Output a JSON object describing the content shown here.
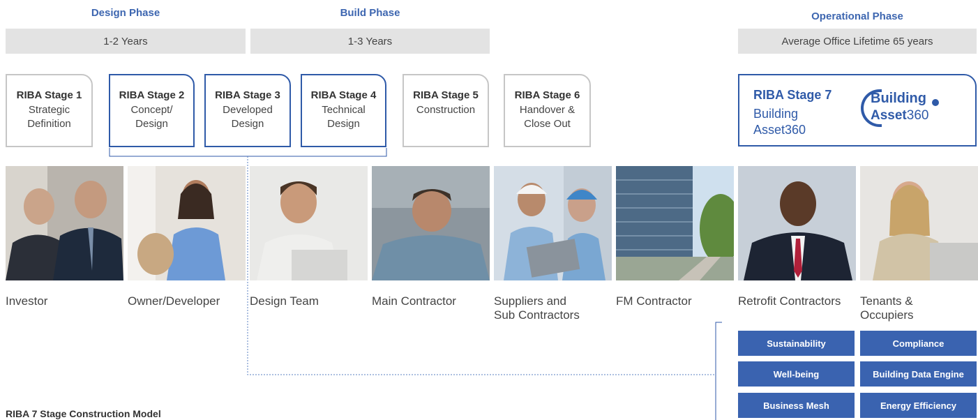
{
  "phases": {
    "design": {
      "title": "Design Phase",
      "duration": "1-2 Years"
    },
    "build": {
      "title": "Build Phase",
      "duration": "1-3 Years"
    },
    "operational": {
      "title": "Operational Phase",
      "duration": "Average Office Lifetime 65 years"
    }
  },
  "stages": [
    {
      "title": "RIBA Stage 1",
      "line1": "Strategic",
      "line2": "Definition"
    },
    {
      "title": "RIBA Stage 2",
      "line1": "Concept/",
      "line2": "Design"
    },
    {
      "title": "RIBA Stage 3",
      "line1": "Developed",
      "line2": "Design"
    },
    {
      "title": "RIBA Stage 4",
      "line1": "Technical",
      "line2": "Design"
    },
    {
      "title": "RIBA Stage 5",
      "line1": "Construction",
      "line2": ""
    },
    {
      "title": "RIBA Stage 6",
      "line1": "Handover &",
      "line2": "Close Out"
    }
  ],
  "stage7": {
    "title": "RIBA Stage 7",
    "line1": "Building",
    "line2": "Asset360",
    "logo_line1": "Building",
    "logo_line2_bold": "Asset",
    "logo_line2_light": "360"
  },
  "stakeholders": [
    {
      "line1": "Investor",
      "line2": ""
    },
    {
      "line1": "Owner/Developer",
      "line2": ""
    },
    {
      "line1": "Design Team",
      "line2": ""
    },
    {
      "line1": "Main Contractor",
      "line2": ""
    },
    {
      "line1": "Suppliers and",
      "line2": "Sub Contractors"
    },
    {
      "line1": "FM Contractor",
      "line2": ""
    },
    {
      "line1": "Retrofit Contractors",
      "line2": ""
    },
    {
      "line1": "Tenants &",
      "line2": "Occupiers"
    }
  ],
  "features": [
    "Sustainability",
    "Compliance",
    "Well-being",
    "Building Data Engine",
    "Business Mesh",
    "Energy Efficiency"
  ],
  "caption": "RIBA 7 Stage Construction Model",
  "colors": {
    "accent": "#2f5aa8",
    "feature_bg": "#3a63b0",
    "phase_bar": "#e3e3e3",
    "stage_border": "#c6c6c6"
  }
}
